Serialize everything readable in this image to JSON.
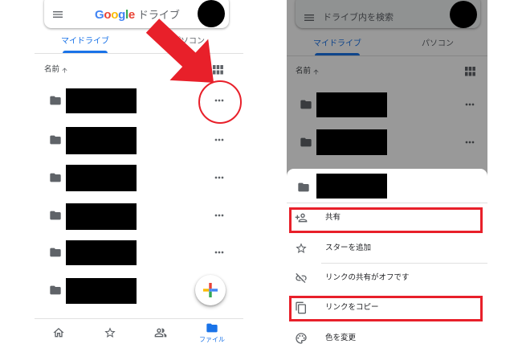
{
  "colors": {
    "accent": "#1a73e8",
    "highlight": "#e8202a",
    "icon": "#5f6368",
    "logo_letters": [
      "#4285f4",
      "#ea4335",
      "#fbbc05",
      "#4285f4",
      "#34a853",
      "#ea4335"
    ]
  },
  "left": {
    "header": {
      "menu_icon": "hamburger-icon",
      "logo": "Google",
      "product": "ドライブ",
      "avatar_icon": "account-avatar"
    },
    "tabs": [
      {
        "label": "マイドライブ",
        "active": true
      },
      {
        "label": "パソコン",
        "active": false
      }
    ],
    "sort": {
      "label": "名前",
      "direction_icon": "arrow-up-icon",
      "view_icon": "grid-view-icon"
    },
    "rows": [
      {
        "icon": "folder-icon",
        "action_icon": "more-horiz-icon"
      },
      {
        "icon": "folder-icon",
        "action_icon": "more-horiz-icon"
      },
      {
        "icon": "folder-icon",
        "action_icon": "more-horiz-icon"
      },
      {
        "icon": "folder-icon",
        "action_icon": "more-horiz-icon"
      },
      {
        "icon": "folder-icon",
        "action_icon": "more-horiz-icon"
      },
      {
        "icon": "folder-icon",
        "action_icon": "more-horiz-icon"
      }
    ],
    "fab_icon": "plus-icon",
    "nav": {
      "items": [
        {
          "icon": "home-icon"
        },
        {
          "icon": "star-icon"
        },
        {
          "icon": "people-icon"
        },
        {
          "icon": "folder-icon",
          "label": "ファイル",
          "active": true
        }
      ]
    }
  },
  "right": {
    "search": {
      "menu_icon": "hamburger-icon",
      "placeholder": "ドライブ内を検索",
      "avatar_icon": "account-avatar"
    },
    "tabs": [
      {
        "label": "マイドライブ",
        "active": true
      },
      {
        "label": "パソコン",
        "active": false
      }
    ],
    "sort": {
      "label": "名前",
      "direction_icon": "arrow-up-icon",
      "view_icon": "grid-view-icon"
    },
    "sheet": {
      "header_icon": "folder-icon",
      "items": [
        {
          "label": "共有",
          "icon": "person-add-icon",
          "highlighted": true
        },
        {
          "label": "スターを追加",
          "icon": "star-icon",
          "highlighted": false
        },
        {
          "label": "リンクの共有がオフです",
          "icon": "link-off-icon",
          "highlighted": false
        },
        {
          "label": "リンクをコピー",
          "icon": "copy-icon",
          "highlighted": true
        },
        {
          "label": "色を変更",
          "icon": "palette-icon",
          "highlighted": false
        }
      ]
    }
  }
}
